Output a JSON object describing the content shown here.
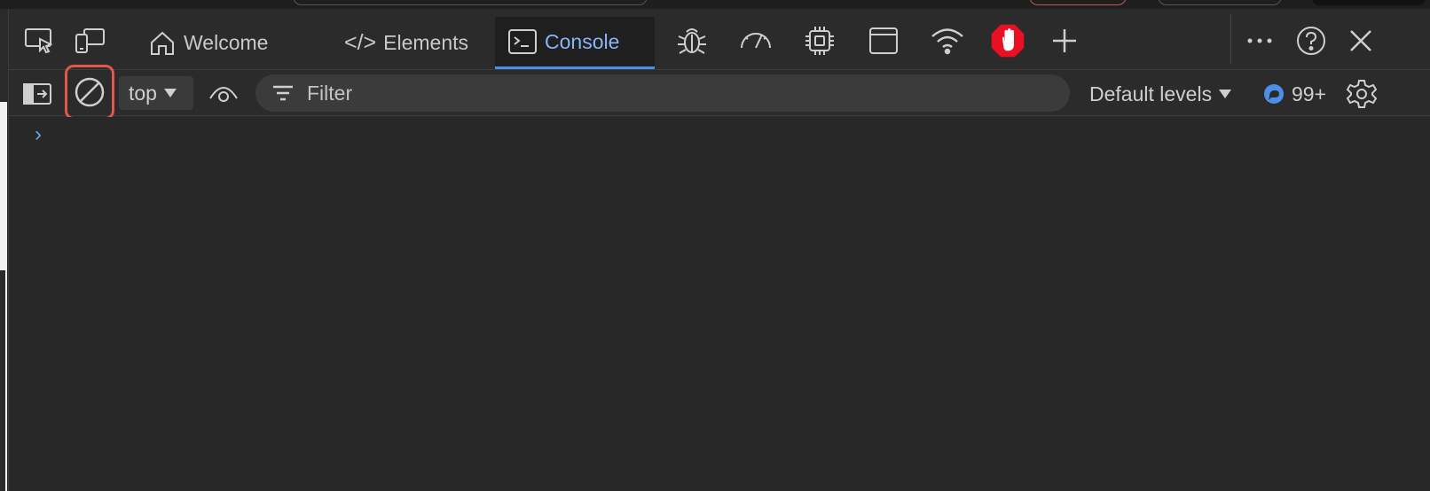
{
  "tabs": {
    "welcome": "Welcome",
    "elements": "Elements",
    "console": "Console"
  },
  "toolbar": {
    "context": "top",
    "filter_placeholder": "Filter",
    "levels": "Default levels",
    "issues_count": "99+"
  },
  "console": {
    "prompt": "›"
  },
  "colors": {
    "accent": "#4c8ee8",
    "active_tab_text": "#8ab4f8",
    "highlight": "#e2574c",
    "stop_red": "#e81123"
  }
}
